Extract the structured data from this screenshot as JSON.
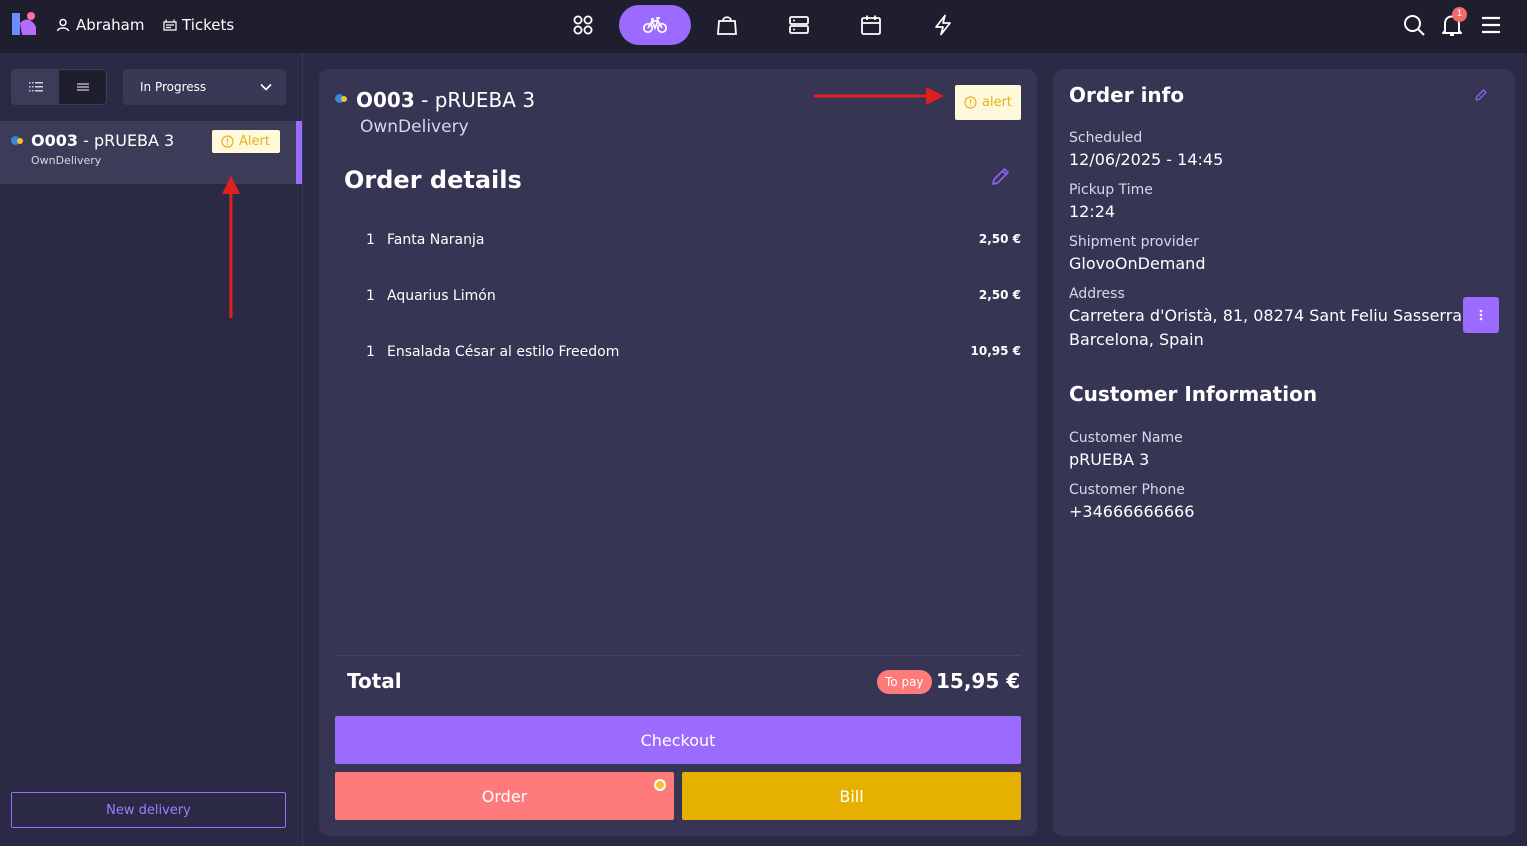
{
  "topbar": {
    "user_name": "Abraham",
    "tickets_label": "Tickets",
    "notification_count": "1",
    "nav_active": "delivery"
  },
  "sidebar": {
    "status_filter": "In Progress",
    "orders": [
      {
        "number": "O003",
        "name": "pRUEBA 3",
        "provider": "OwnDelivery",
        "badge": "Alert"
      }
    ],
    "new_delivery_label": "New delivery"
  },
  "order": {
    "number": "O003",
    "name": "pRUEBA 3",
    "provider": "OwnDelivery",
    "badge": "alert",
    "details_heading": "Order details",
    "items": [
      {
        "qty": "1",
        "name": "Fanta Naranja",
        "price": "2,50 €"
      },
      {
        "qty": "1",
        "name": "Aquarius Limón",
        "price": "2,50 €"
      },
      {
        "qty": "1",
        "name": "Ensalada César al estilo Freedom",
        "price": "10,95 €"
      }
    ],
    "total_label": "Total",
    "to_pay_label": "To pay",
    "total_value": "15,95 €",
    "checkout_label": "Checkout",
    "order_label": "Order",
    "bill_label": "Bill"
  },
  "order_info": {
    "heading": "Order info",
    "scheduled_label": "Scheduled",
    "scheduled_value": "12/06/2025 - 14:45",
    "pickup_label": "Pickup Time",
    "pickup_value": "12:24",
    "shipment_label": "Shipment provider",
    "shipment_value": "GlovoOnDemand",
    "address_label": "Address",
    "address_line1": "Carretera d'Oristà, 81, 08274 Sant Feliu Sasserra,",
    "address_line2": "Barcelona, Spain"
  },
  "customer_info": {
    "heading": "Customer Information",
    "name_label": "Customer Name",
    "name_value": "pRUEBA 3",
    "phone_label": "Customer Phone",
    "phone_value": "+34666666666"
  },
  "colors": {
    "accent": "#9b6bff",
    "order_button": "#ff7b7b",
    "bill_button": "#e6b000",
    "alert_bg": "#fff9db",
    "alert_text": "#e6b120",
    "annotation_arrow": "#e02020"
  }
}
